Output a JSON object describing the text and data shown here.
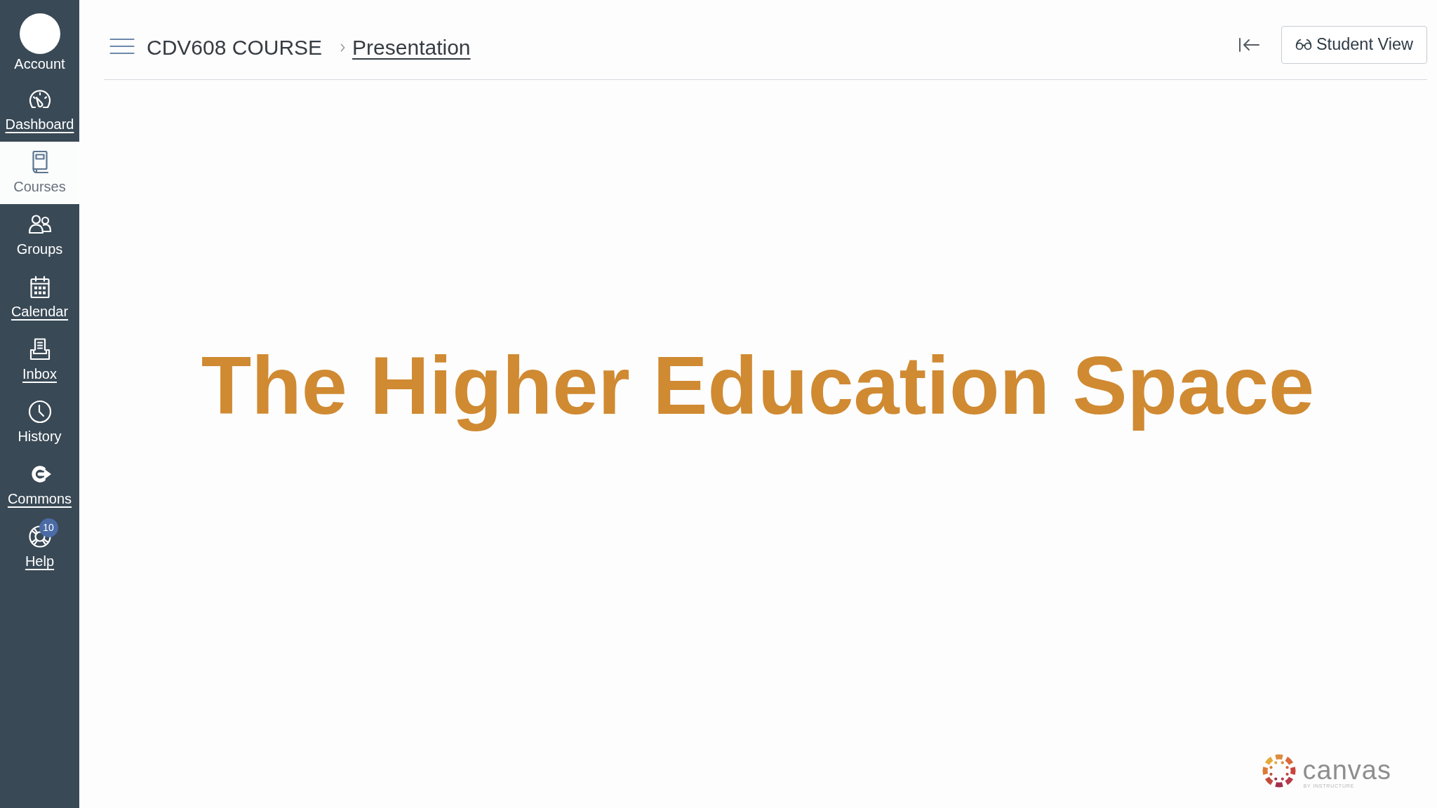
{
  "sidebar": {
    "items": [
      {
        "kind": "avatar",
        "label": "Account",
        "selected": false,
        "underlined": false
      },
      {
        "kind": "icon",
        "label": "Dashboard",
        "selected": false,
        "underlined": true
      },
      {
        "kind": "icon",
        "label": "Courses",
        "selected": true,
        "underlined": false
      },
      {
        "kind": "icon",
        "label": "Groups",
        "selected": false,
        "underlined": false
      },
      {
        "kind": "icon",
        "label": "Calendar",
        "selected": false,
        "underlined": true
      },
      {
        "kind": "icon",
        "label": "Inbox",
        "selected": false,
        "underlined": true
      },
      {
        "kind": "icon",
        "label": "History",
        "selected": false,
        "underlined": false
      },
      {
        "kind": "icon",
        "label": "Commons",
        "selected": false,
        "underlined": true
      },
      {
        "kind": "icon",
        "label": "Help",
        "selected": false,
        "underlined": true,
        "badge": "10"
      }
    ]
  },
  "header": {
    "breadcrumb": [
      {
        "label": "CDV608 COURSE",
        "underlined": false
      },
      {
        "label": "Presentation",
        "underlined": true
      }
    ],
    "student_view_button": "Student View"
  },
  "slide": {
    "title": "The Higher Education Space"
  },
  "logo": {
    "wordmark": "canvas",
    "tagline": "BY INSTRUCTURE"
  }
}
